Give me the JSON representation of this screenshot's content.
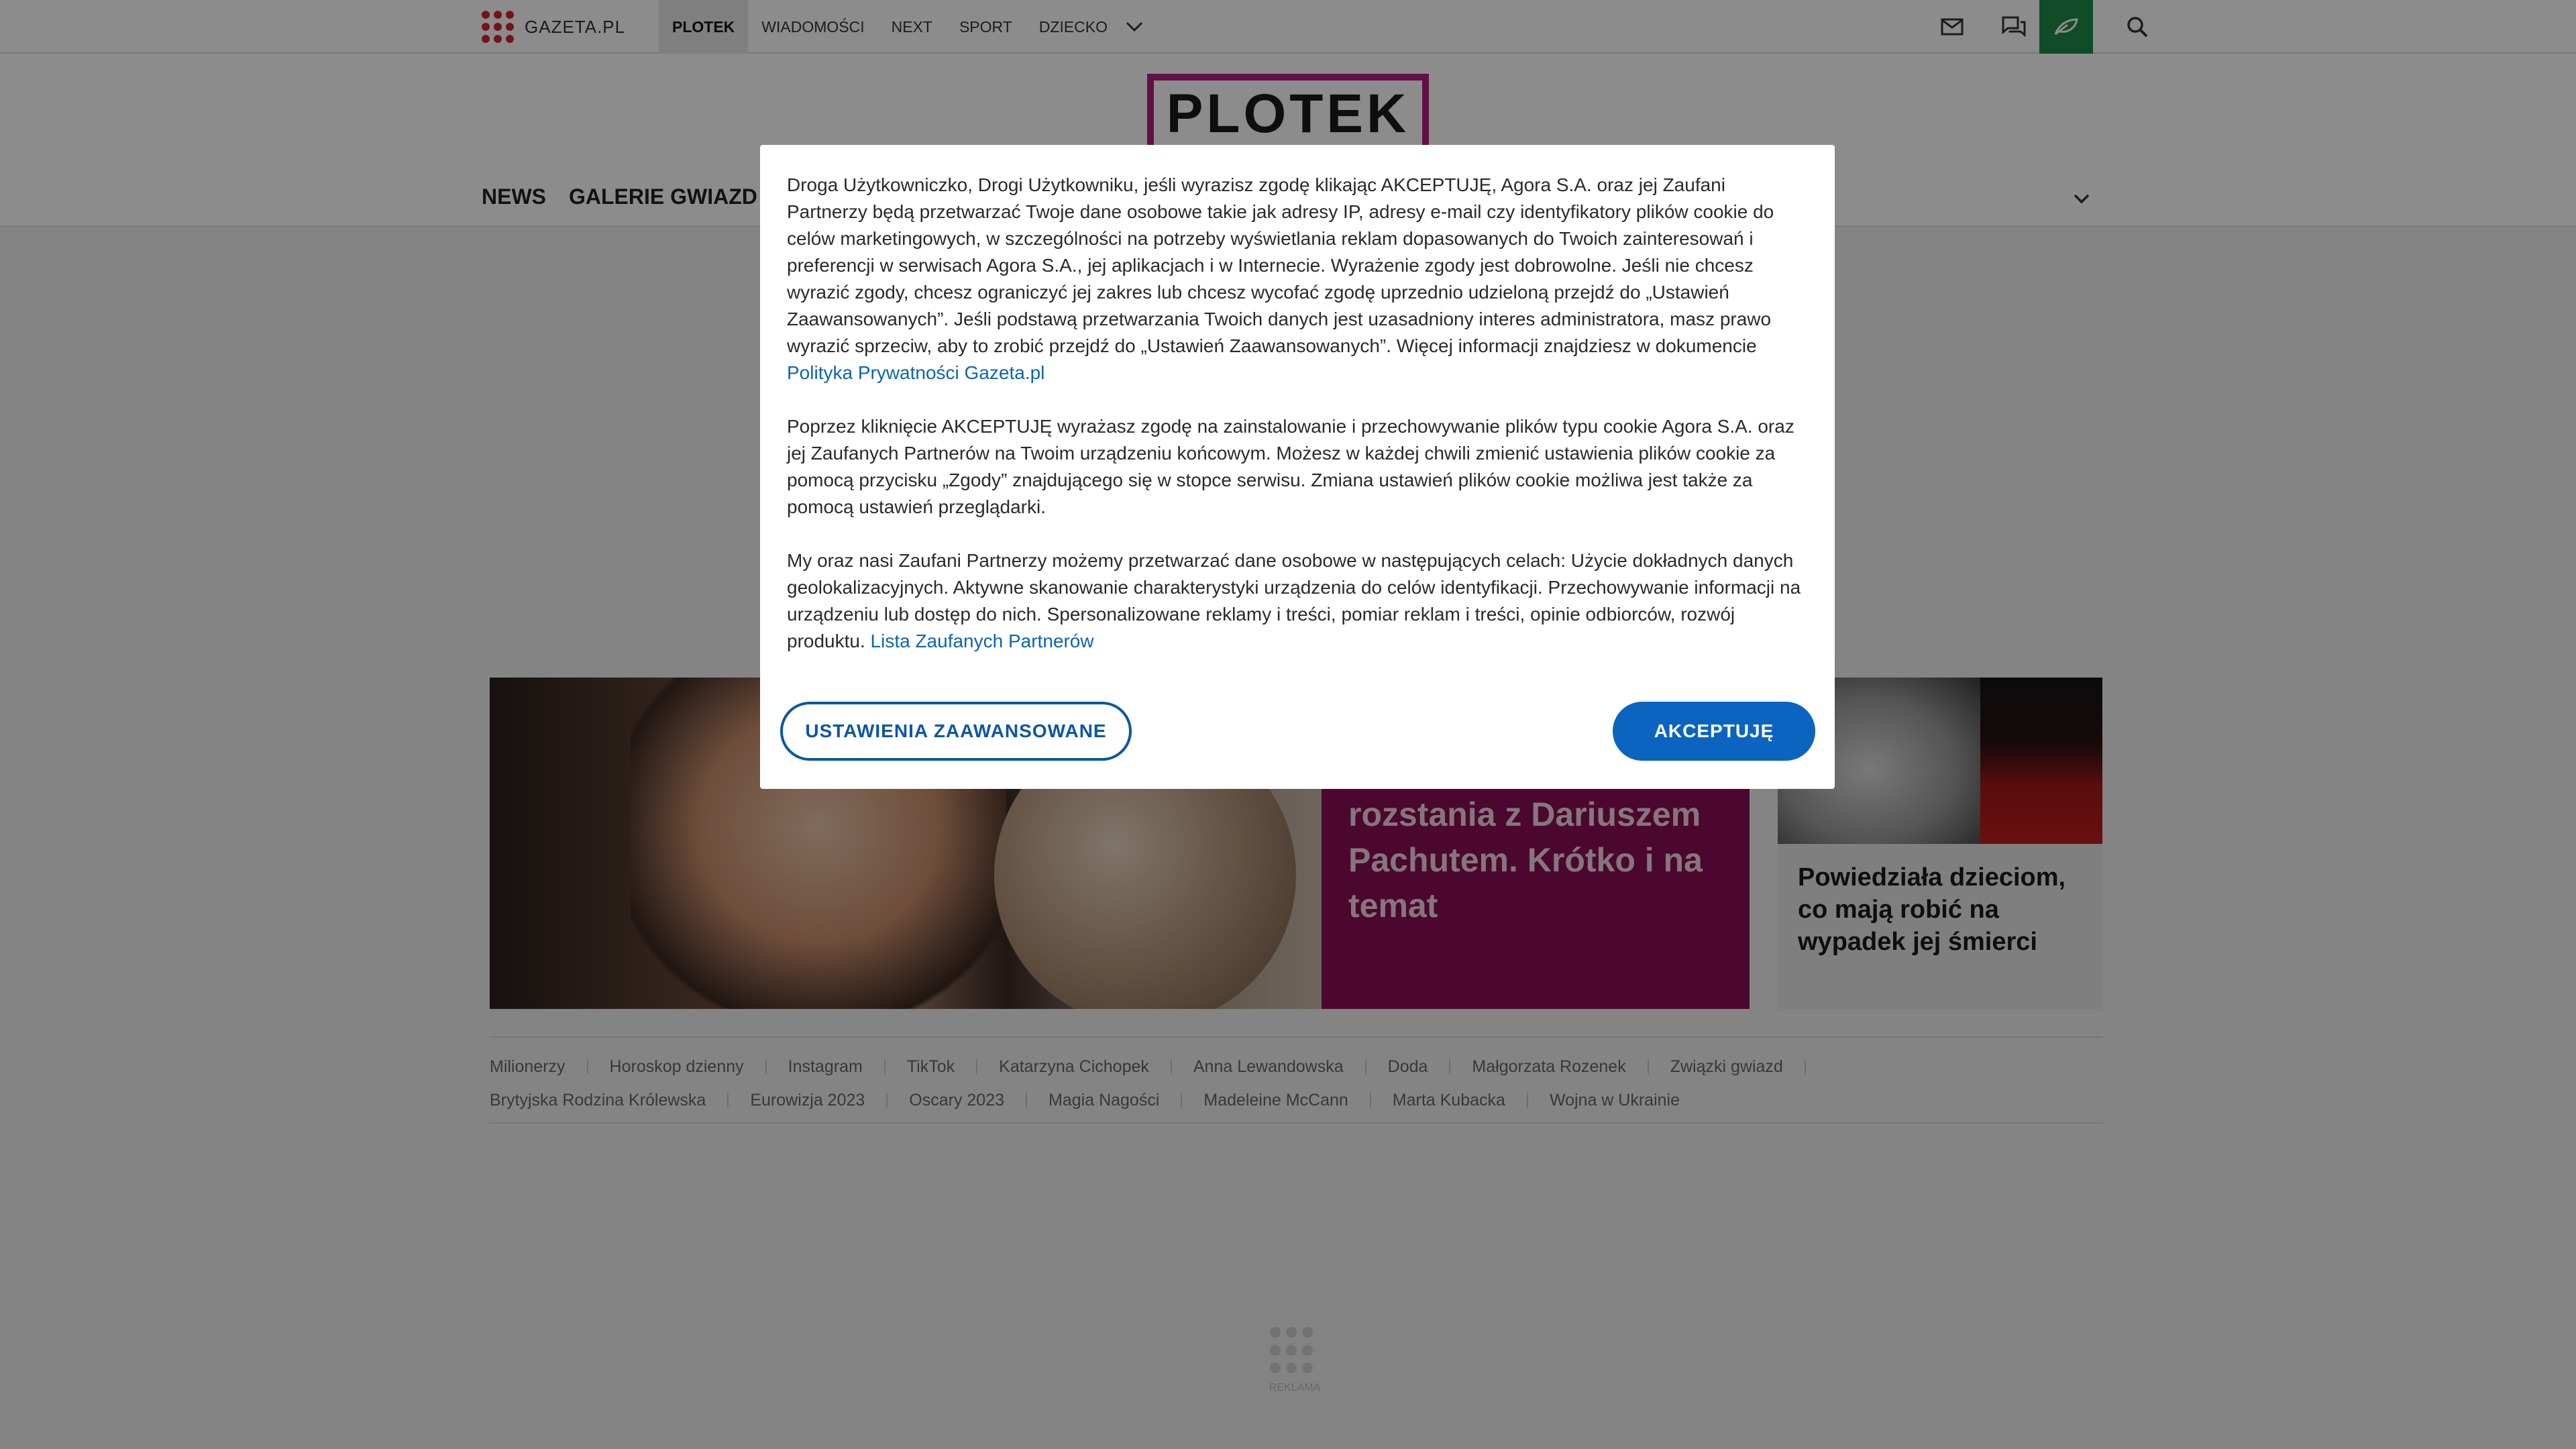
{
  "topbar": {
    "logo_text": "GAZETA.PL",
    "nav": [
      {
        "label": "PLOTEK",
        "active": true
      },
      {
        "label": "WIADOMOŚCI"
      },
      {
        "label": "NEXT"
      },
      {
        "label": "SPORT"
      },
      {
        "label": "DZIECKO"
      }
    ],
    "icons": [
      "mail-icon",
      "chat-icon",
      "user-icon",
      "search-icon",
      "leaf-icon"
    ]
  },
  "site": {
    "logo_text": "PLOTEK",
    "nav": [
      "NEWS",
      "GALERIE GWIAZD"
    ]
  },
  "featured": {
    "title": "rozstania z Dariuszem Pachutem. Krótko i na temat"
  },
  "side_card": {
    "title": "Powiedziała dzieciom, co mają robić na wypadek jej śmierci"
  },
  "tags": {
    "row1": [
      "Milionerzy",
      "Horoskop dzienny",
      "Instagram",
      "TikTok",
      "Katarzyna Cichopek",
      "Anna Lewandowska",
      "Doda",
      "Małgorzata Rozenek",
      "Związki gwiazd"
    ],
    "row2": [
      "Brytyjska Rodzina Królewska",
      "Eurowizja 2023",
      "Oscary 2023",
      "Magia Nagości",
      "Madeleine McCann",
      "Marta Kubacka",
      "Wojna w Ukrainie"
    ]
  },
  "ad": {
    "label": "REKLAMA"
  },
  "consent": {
    "p1": "Droga Użytkowniczko, Drogi Użytkowniku, jeśli wyrazisz zgodę klikając AKCEPTUJĘ, Agora S.A. oraz jej Zaufani Partnerzy będą przetwarzać Twoje dane osobowe takie jak adresy IP, adresy e-mail czy identyfikatory plików cookie do celów marketingowych, w szczególności na potrzeby wyświetlania reklam dopasowanych do Twoich zainteresowań i preferencji w serwisach Agora S.A., jej aplikacjach i w Internecie. Wyrażenie zgody jest dobrowolne. Jeśli nie chcesz wyrazić zgody, chcesz ograniczyć jej zakres lub chcesz wycofać zgodę uprzednio udzieloną przejdź do „Ustawień Zaawansowanych”. Jeśli podstawą przetwarzania Twoich danych jest uzasadniony interes administratora, masz prawo wyrazić sprzeciw, aby to zrobić przejdź do „Ustawień Zaawansowanych”. Więcej informacji znajdziesz w dokumencie",
    "p1_link": "Polityka Prywatności Gazeta.pl",
    "p2": "Poprzez kliknięcie AKCEPTUJĘ wyrażasz zgodę na zainstalowanie i przechowywanie plików typu cookie Agora S.A. oraz jej Zaufanych Partnerów na Twoim urządzeniu końcowym. Możesz w każdej chwili zmienić ustawienia plików cookie za pomocą przycisku „Zgody” znajdującego się w stopce serwisu. Zmiana ustawień plików cookie możliwa jest także za pomocą ustawień przeglądarki.",
    "p3": "My oraz nasi Zaufani Partnerzy możemy przetwarzać dane osobowe w następujących celach: Użycie dokładnych danych geolokalizacyjnych. Aktywne skanowanie charakterystyki urządzenia do celów identyfikacji. Przechowywanie informacji na urządzeniu lub dostęp do nich. Spersonalizowane reklamy i treści, pomiar reklam i treści, opinie odbiorców, rozwój produktu.",
    "p3_link": "Lista Zaufanych Partnerów",
    "settings_button": "USTAWIENIA ZAAWANSOWANE",
    "accept_button": "AKCEPTUJĘ"
  },
  "colors": {
    "brand_red": "#d6262d",
    "plotek_magenta": "#b01f7e",
    "accept_blue": "#0b64c0",
    "eco_green": "#1e8a48"
  }
}
